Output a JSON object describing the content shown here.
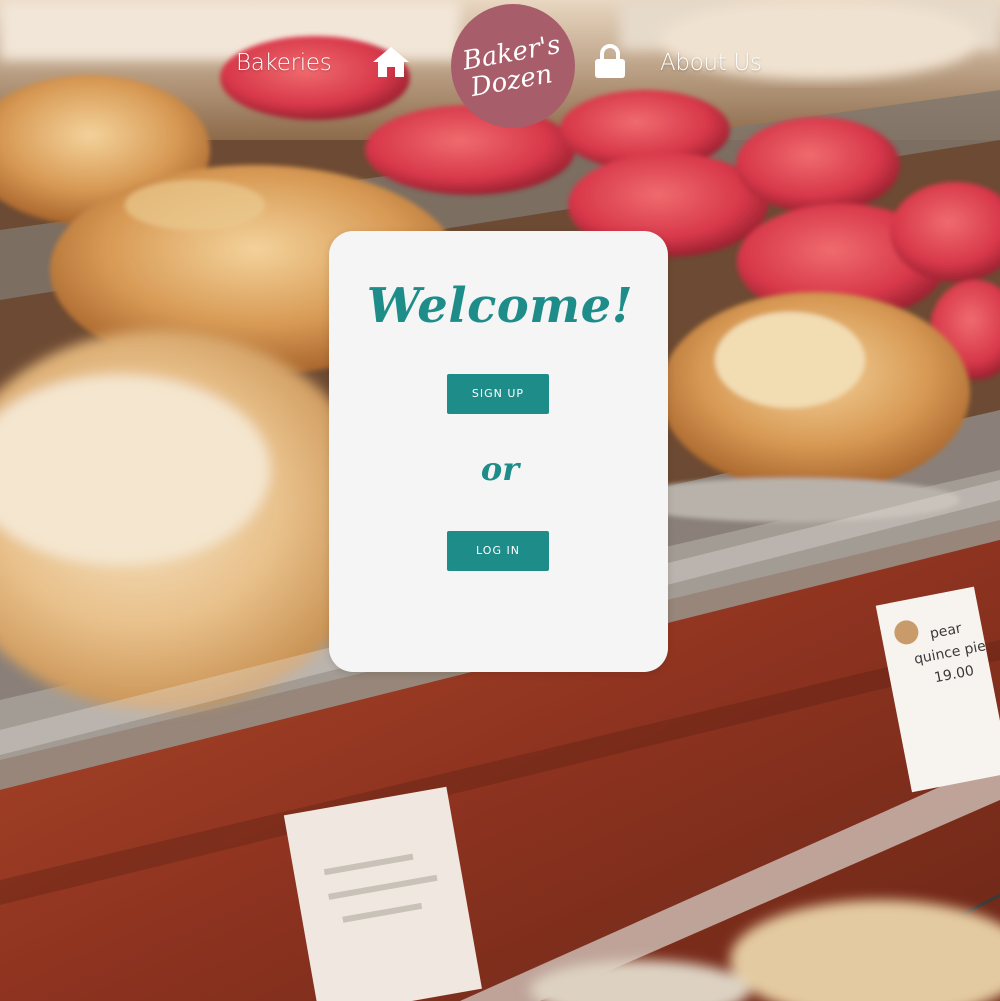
{
  "nav": {
    "bakeries_label": "Bakeries",
    "about_label": "About Us",
    "home_icon": "home-icon",
    "lock_icon": "lock-icon"
  },
  "logo": {
    "line1": "Baker's",
    "line2": "Dozen",
    "circle_color": "#a85d6a"
  },
  "welcome": {
    "title": "Welcome!",
    "signup_label": "SIGN UP",
    "or_text": "or",
    "login_label": "LOG IN"
  },
  "signs": {
    "right": [
      "pear",
      "quince pie",
      "19.00"
    ]
  },
  "colors": {
    "accent": "#1e8d8a",
    "card": "#f5f5f5",
    "logo": "#a85d6a"
  }
}
